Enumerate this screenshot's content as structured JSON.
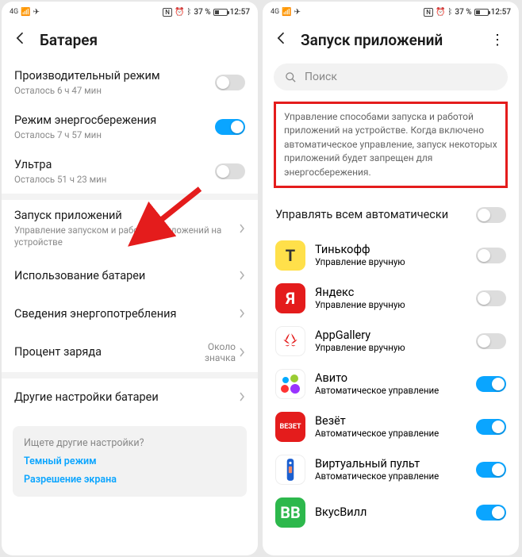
{
  "status": {
    "signal": "4G",
    "nfclabel": "N",
    "battery_pct": "37 %",
    "time": "12:57"
  },
  "left": {
    "title": "Батарея",
    "rows": {
      "perf": {
        "title": "Производительный режим",
        "sub": "Осталось 6 ч 47 мин",
        "on": false
      },
      "save": {
        "title": "Режим энергосбережения",
        "sub": "Осталось 7 ч 57 мин",
        "on": true
      },
      "ultra": {
        "title": "Ультра",
        "sub": "Осталось 51 ч 23 мин",
        "on": false
      },
      "launch": {
        "title": "Запуск приложений",
        "sub": "Управление запуском и работой приложений на устройстве"
      },
      "usage": {
        "title": "Использование батареи"
      },
      "details": {
        "title": "Сведения энергопотребления"
      },
      "pct": {
        "title": "Процент заряда",
        "value": "Около значка"
      },
      "other": {
        "title": "Другие настройки батареи"
      }
    },
    "tips": {
      "q": "Ищете другие настройки?",
      "link1": "Темный режим",
      "link2": "Разрешение экрана"
    }
  },
  "right": {
    "title": "Запуск приложений",
    "search_placeholder": "Поиск",
    "info": "Управление способами запуска и работой приложений на устройстве. Когда включено автоматическое управление, запуск некоторых приложений будет запрещен для энергосбережения.",
    "manage_all": {
      "title": "Управлять всем автоматически",
      "on": false
    },
    "apps": [
      {
        "name": "Тинькофф",
        "sub": "Управление вручную",
        "on": false,
        "icon_bg": "#ffe04a",
        "icon_text": "Т",
        "icon_color": "#333"
      },
      {
        "name": "Яндекс",
        "sub": "Управление вручную",
        "on": false,
        "icon_bg": "#e41c1c",
        "icon_text": "Я",
        "icon_color": "#fff"
      },
      {
        "name": "AppGallery",
        "sub": "Управление вручную",
        "on": false,
        "icon_bg": "#fff",
        "icon_text": "",
        "icon_color": "#e41c1c",
        "huawei": true
      },
      {
        "name": "Авито",
        "sub": "Автоматическое управление",
        "on": true,
        "icon_bg": "#fff",
        "icon_text": "",
        "avito": true
      },
      {
        "name": "Везёт",
        "sub": "Автоматическое управление",
        "on": true,
        "icon_bg": "#e41c1c",
        "icon_text": "ВЕЗЕТ",
        "icon_color": "#fff",
        "small": true
      },
      {
        "name": "Виртуальный пульт",
        "sub": "Автоматическое управление",
        "on": true,
        "icon_bg": "#fff",
        "icon_text": "",
        "remote": true
      },
      {
        "name": "ВкусВилл",
        "sub": "",
        "on": true,
        "icon_bg": "#2db84c",
        "icon_text": "ВВ",
        "icon_color": "#fff"
      }
    ]
  }
}
